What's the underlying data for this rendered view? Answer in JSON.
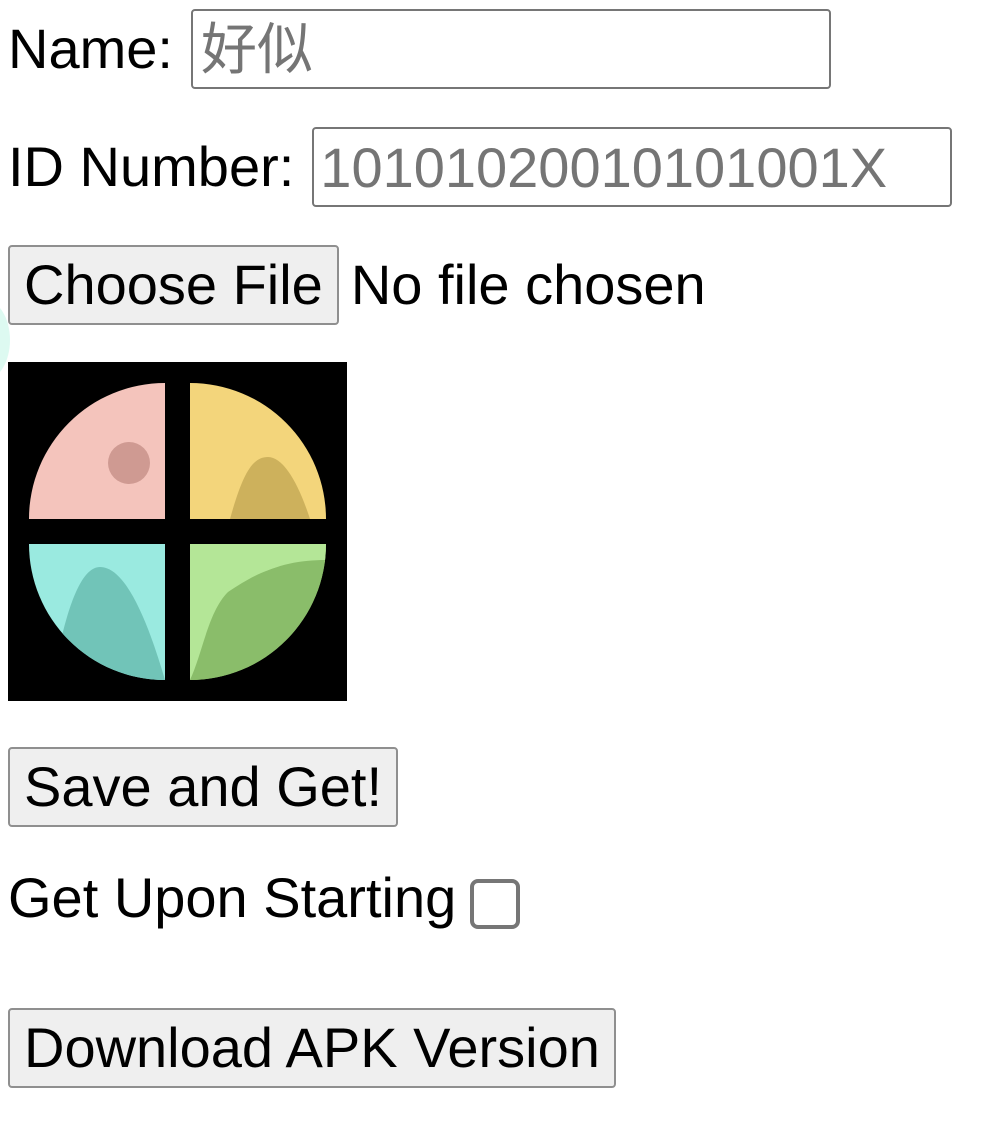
{
  "form": {
    "name_label": "Name:",
    "name_placeholder": "好似",
    "name_value": "",
    "id_label": "ID Number:",
    "id_placeholder": "1010102001010100​1X",
    "id_value": "",
    "file_button_label": "Choose File",
    "file_status": "No file chosen",
    "save_button_label": "Save and Get!",
    "auto_get_label": "Get Upon Starting",
    "auto_get_checked": false,
    "download_button_label": "Download APK Version"
  },
  "logo": {
    "icon": "four-quadrant-circle-logo",
    "colors": {
      "background": "#000000",
      "top_left": "#f4c4bc",
      "top_left_dot": "#cf9a92",
      "top_right": "#f3d57b",
      "top_right_wave": "#cdb15c",
      "bottom_left": "#9aeae0",
      "bottom_left_wave": "#71c4b8",
      "bottom_right": "#8abd6a",
      "bottom_right_wave": "#b4e697"
    }
  }
}
